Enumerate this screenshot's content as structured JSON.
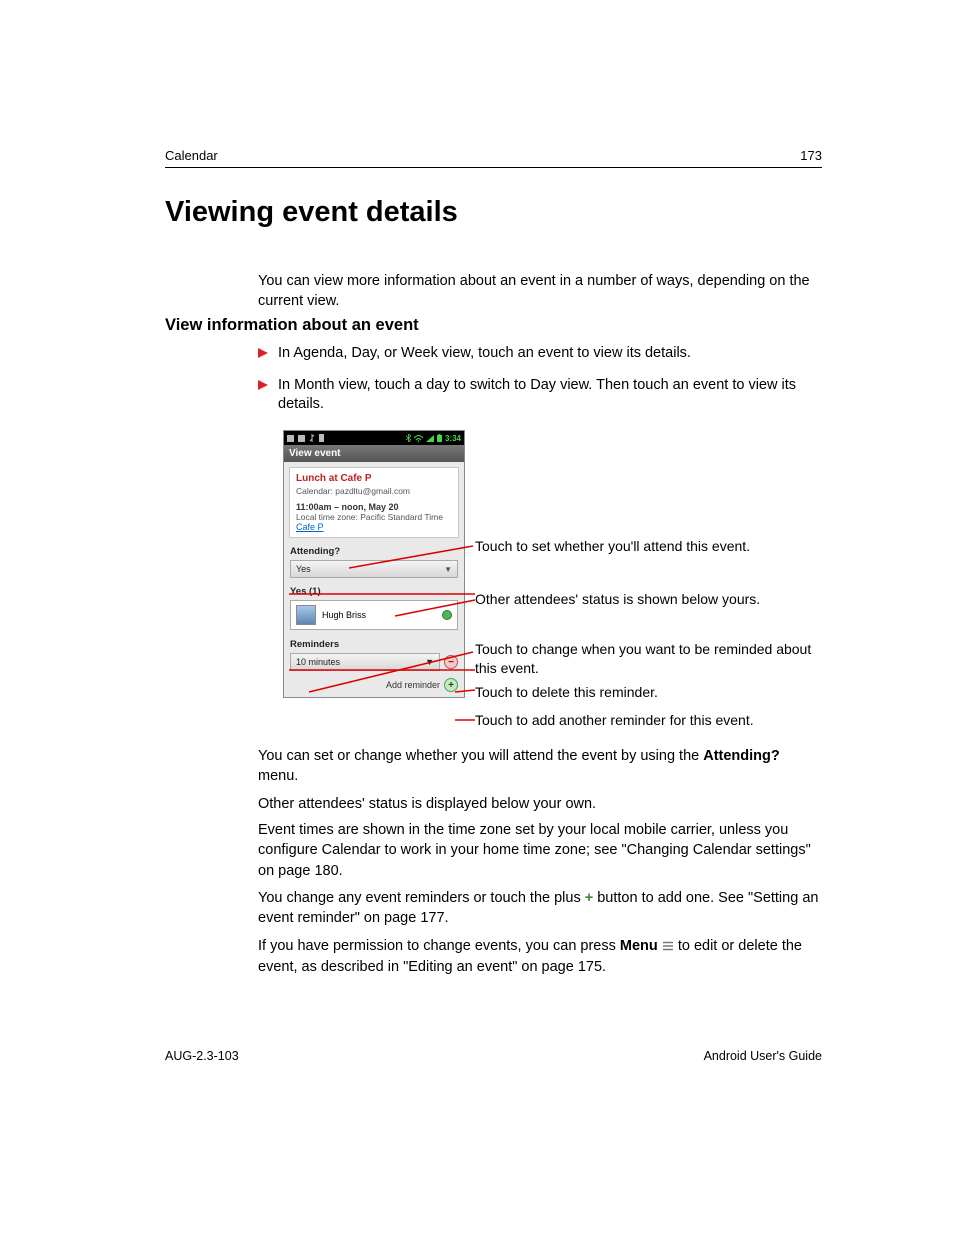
{
  "header": {
    "section": "Calendar",
    "page_number": "173"
  },
  "title": "Viewing event details",
  "intro": "You can view more information about an event in a number of ways, depending on the current view.",
  "subheading": "View information about an event",
  "bullets": [
    "In Agenda, Day, or Week view, touch an event to view its details.",
    "In Month view, touch a day to switch to Day view. Then touch an event to view its details."
  ],
  "screenshot": {
    "statusbar_time": "3:34",
    "window_title": "View event",
    "event": {
      "title": "Lunch at Cafe P",
      "calendar_label": "Calendar:",
      "calendar_value": "pazdltu@gmail.com",
      "time": "11:00am – noon, May 20",
      "timezone": "Local time zone: Pacific Standard Time",
      "location_link": "Cafe P"
    },
    "attending_label": "Attending?",
    "attending_value": "Yes",
    "yes_count_label": "Yes (1)",
    "attendee_name": "Hugh Briss",
    "reminders_label": "Reminders",
    "reminder_value": "10 minutes",
    "add_reminder_label": "Add reminder"
  },
  "callouts": {
    "c1": "Touch to set whether you'll attend this event.",
    "c2": "Other attendees' status is shown below yours.",
    "c3": "Touch to change when you want to be reminded about this event.",
    "c4": "Touch to delete this reminder.",
    "c5": "Touch to add another reminder for this event."
  },
  "paragraphs": {
    "p1a": "You can set or change whether you will attend the event by using the ",
    "p1b": "Attending?",
    "p1c": " menu.",
    "p2": "Other attendees' status is displayed below your own.",
    "p3": "Event times are shown in the time zone set by your local mobile carrier, unless you configure Calendar to work in your home time zone; see \"Changing Calendar settings\" on page 180.",
    "p4a": "You change any event reminders or touch the plus ",
    "p4b": " button to add one. See \"Setting an event reminder\" on page 177.",
    "p5a": "If you have permission to change events, you can press ",
    "p5b": "Menu",
    "p5c": " to edit or delete the event, as described in \"Editing an event\" on page 175."
  },
  "footer": {
    "left": "AUG-2.3-103",
    "right": "Android User's Guide"
  }
}
